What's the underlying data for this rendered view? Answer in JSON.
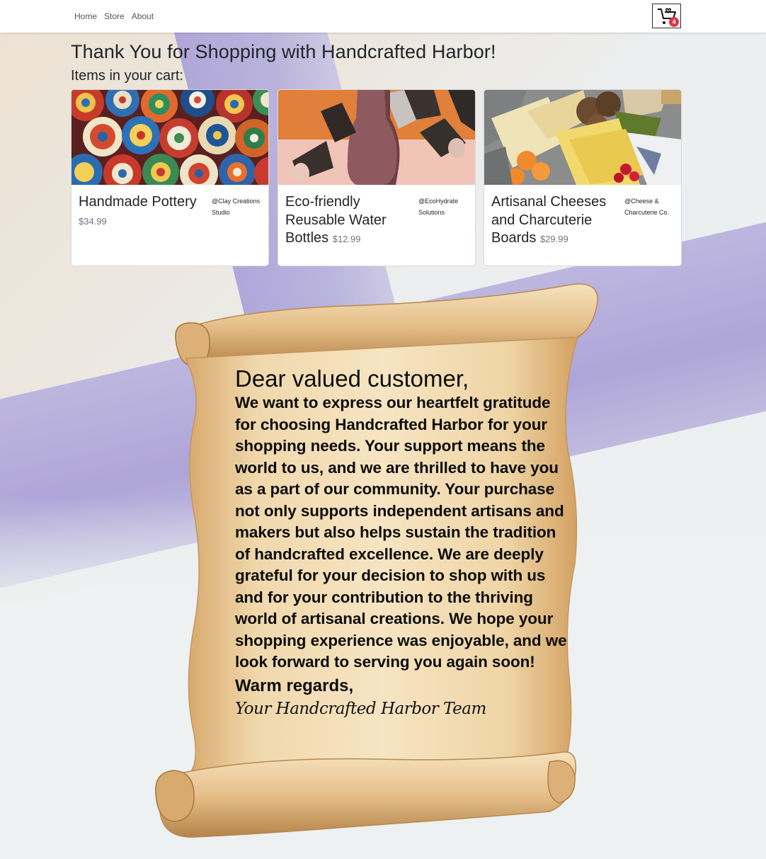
{
  "nav": {
    "links": [
      "Home",
      "Store",
      "About"
    ],
    "cart_count": "4"
  },
  "page": {
    "title": "Thank You for Shopping with Handcrafted Harbor!",
    "cart_heading": "Items in your cart:"
  },
  "cart_items": [
    {
      "name": "Handmade Pottery",
      "price": "$34.99",
      "shop": "@Clay Creations Studio",
      "image": "pottery-plates-photo"
    },
    {
      "name": "Eco-friendly Reusable Water Bottles",
      "price": "$12.99",
      "shop": "@EcoHydrate Solutions",
      "image": "bottles-cups-photo"
    },
    {
      "name": "Artisanal Cheeses and Charcuterie Boards",
      "price": "$29.99",
      "shop": "@Cheese & Charcuterie Co.",
      "image": "cheese-board-photo"
    }
  ],
  "letter": {
    "greeting": "Dear valued customer,",
    "message": "We want to express our heartfelt gratitude for choosing Handcrafted Harbor for your shopping needs. Your support means the world to us, and we are thrilled to have you as a part of our community. Your purchase not only supports independent artisans and makers but also helps sustain the tradition of handcrafted excellence. We are deeply grateful for your decision to shop with us and for your contribution to the thriving world of artisanal creations. We hope your shopping experience was enjoyable, and we look forward to serving you again soon!",
    "closing": "Warm regards,",
    "signature": "Your Handcrafted Harbor Team"
  },
  "colors": {
    "badge": "#dc3545",
    "parchment": "#e7c48c",
    "background_stripe": "#a99fd6"
  }
}
